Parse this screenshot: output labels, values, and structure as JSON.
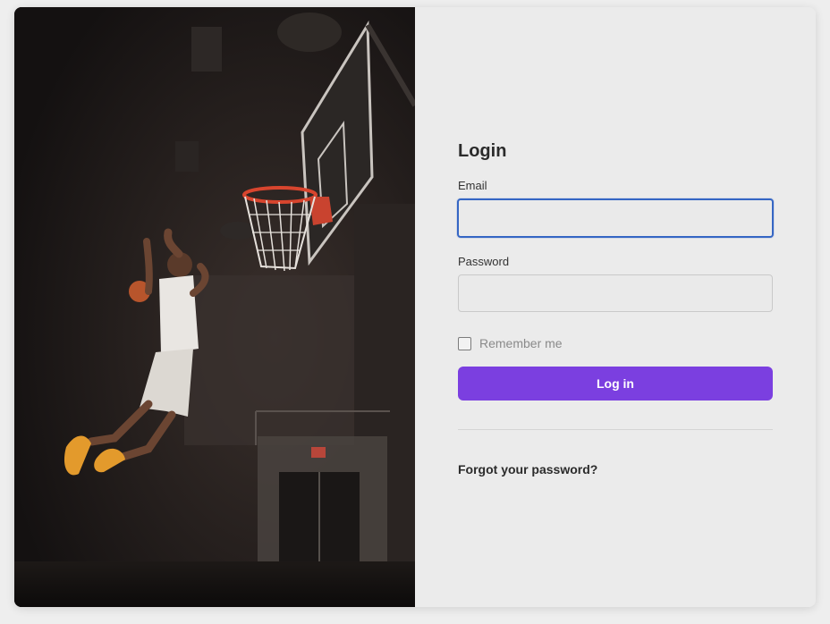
{
  "hero": {
    "alt": "Basketball player dunking in a dark gym",
    "exit_sign": "EXIT"
  },
  "login": {
    "title": "Login",
    "email_label": "Email",
    "email_value": "",
    "password_label": "Password",
    "password_value": "",
    "remember_label": "Remember me",
    "remember_checked": false,
    "submit_label": "Log in",
    "forgot_link": "Forgot your password?"
  },
  "colors": {
    "accent": "#7b3fe0",
    "focus_ring": "#3566c4",
    "panel_bg": "#ebebeb",
    "page_bg": "#eeeeee"
  }
}
